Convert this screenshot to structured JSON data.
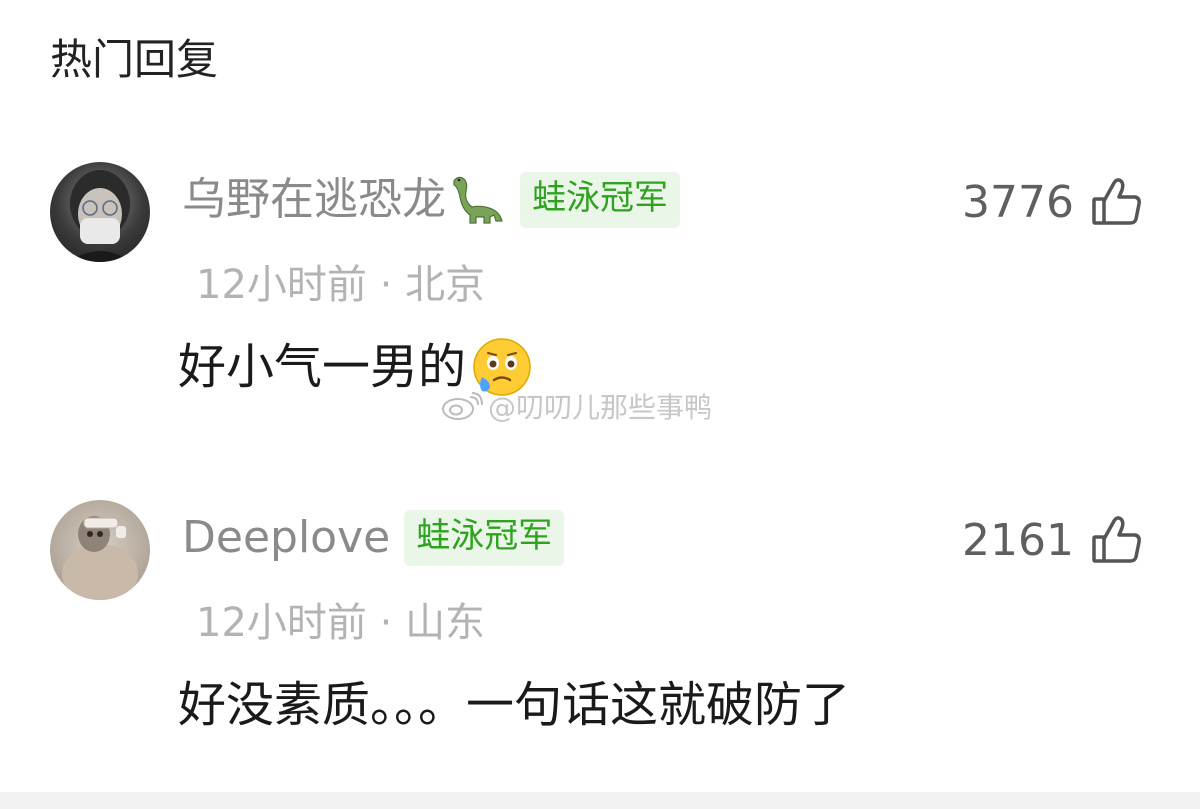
{
  "section": {
    "title": "热门回复"
  },
  "comments": [
    {
      "username": "乌野在逃恐龙",
      "name_emoji": "sauropod-emoji",
      "badge": "蛙泳冠军",
      "likes": "3776",
      "time": "12小时前",
      "separator": "·",
      "location": "北京",
      "text": "好小气一男的",
      "text_emoji": "face-holding-back-tears-emoji"
    },
    {
      "username": "Deeplove",
      "badge": "蛙泳冠军",
      "likes": "2161",
      "time": "12小时前",
      "separator": "·",
      "location": "山东",
      "text": "好没素质。。。一句话这就破防了"
    }
  ],
  "watermark": {
    "text": "@叨叨儿那些事鸭"
  },
  "colors": {
    "badge_bg": "#eaf7e8",
    "badge_text": "#2fa31f",
    "username": "#8a8a8a",
    "meta": "#b3b3b3"
  }
}
